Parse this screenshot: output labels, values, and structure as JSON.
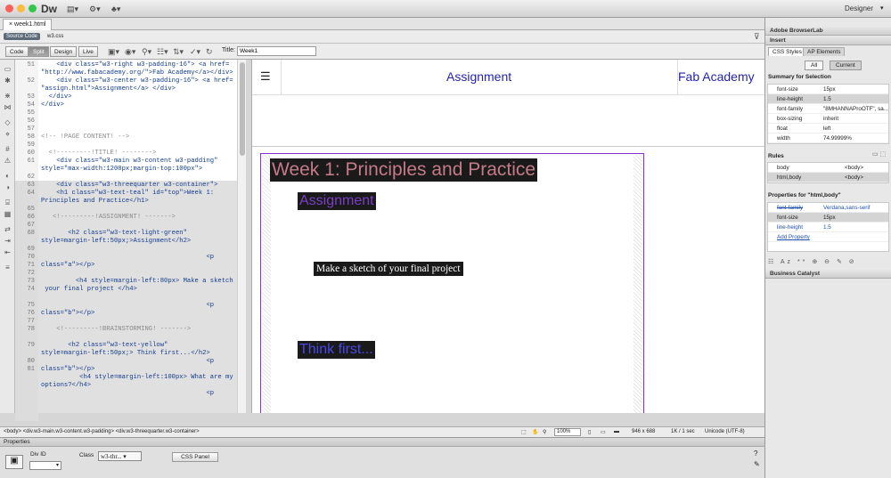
{
  "app": {
    "name": "Dw",
    "workspace": "Designer",
    "toolbar_icons": [
      "layout-menu-icon",
      "gear-menu-icon",
      "site-menu-icon"
    ]
  },
  "doc_tab": {
    "label": "week1.html"
  },
  "related": {
    "source_label": "Source Code",
    "file": "w3.css"
  },
  "views": {
    "code": "Code",
    "split": "Split",
    "design": "Design",
    "live": "Live",
    "active": "Split"
  },
  "title_field": {
    "label": "Title:",
    "value": "Week1"
  },
  "code": {
    "line_numbers": [
      "51",
      "52",
      "53",
      "54",
      "55",
      "56",
      "57",
      "58",
      "59",
      "60",
      "61",
      "62",
      "63",
      "64",
      "65",
      "66",
      "67",
      "68",
      "69",
      "70",
      "71",
      "72",
      "73",
      "74",
      "75",
      "76",
      "77",
      "78",
      "79",
      "80",
      "81"
    ],
    "lines": [
      "    <div class=\"w3-right w3-padding-16\"> <a href=",
      "\"http://www.fabacademy.org/\">Fab Academy</a></div>",
      "    <div class=\"w3-center w3-padding-16\"> <a href=",
      "\"assign.html\">Assignment</a> </div>",
      "  </div>",
      "</div>",
      "",
      "",
      "",
      "<!-- !PAGE CONTENT! -->",
      "",
      "  <!---------!TITLE! -------->",
      "    <div class=\"w3-main w3-content w3-padding\"",
      "style=\"max-width:1200px;margin-top:100px\">",
      "",
      "    <div class=\"w3-threequarter w3-container\">",
      "    <h1 class=\"w3-text-teal\" id=\"top\">Week 1:",
      "Principles and Practice</h1>",
      "",
      "   <!---------!ASSIGNMENT! ------->",
      "",
      "       <h2 class=\"w3-text-light-green\"",
      "style=margin-left:50px;>Assignment</h2>",
      "",
      "                                           <p",
      "class=\"a\"></p>",
      "",
      "         <h4 style=margin-left:80px> Make a sketch of",
      " your final project </h4>",
      "",
      "                                           <p",
      "class=\"b\"></p>",
      "",
      "    <!---------!BRAINSTORMING! ------->",
      "",
      "       <h2 class=\"w3-text-yellow\"",
      "style=margin-left:50px;> Think first...</h2>",
      "                                           <p",
      "class=\"b\"></p>",
      "          <h4 style=margin-left:100px> What are my",
      "options?</h4>",
      "                                           <p"
    ]
  },
  "design": {
    "header_assignment": "Assignment",
    "header_fab": "Fab Academy",
    "h1": "Week 1: Principles and Practice",
    "h2_assignment": "Assignment",
    "h4_sketch": "Make a sketch of your final project",
    "h2_think": "Think first..."
  },
  "status": {
    "tag_selector": "<body> <div.w3-main.w3-content.w3-padding> <div.w3-threequarter.w3-container>",
    "zoom": "100%",
    "dimensions": "946 x 688",
    "download": "1K / 1 sec",
    "encoding": "Unicode (UTF-8)"
  },
  "properties": {
    "title": "Properties",
    "div_id_label": "Div ID",
    "class_label": "Class",
    "class_value": "w3-thr...",
    "css_panel_button": "CSS Panel"
  },
  "right_panel": {
    "browserlab": "Adobe BrowserLab",
    "insert": "Insert",
    "tab_css": "CSS Styles",
    "tab_ap": "AP Elements",
    "seg_all": "All",
    "seg_current": "Current",
    "summary_title": "Summary for Selection",
    "summary": [
      {
        "prop": "font-size",
        "val": "15px"
      },
      {
        "prop": "line-height",
        "val": "1.5"
      },
      {
        "prop": "font-family",
        "val": "\"8MHANNAProOTF\", sa..."
      },
      {
        "prop": "box-sizing",
        "val": "inherit"
      },
      {
        "prop": "float",
        "val": "left"
      },
      {
        "prop": "width",
        "val": "74.99999%"
      }
    ],
    "rules_title": "Rules",
    "rules": [
      {
        "sel": "body",
        "tag": "<body>"
      },
      {
        "sel": "html,body",
        "tag": "<body>"
      }
    ],
    "props_title": "Properties for \"html,body\"",
    "props": [
      {
        "prop": "font-family",
        "val": "Verdana,sans-serif"
      },
      {
        "prop": "font-size",
        "val": "15px"
      },
      {
        "prop": "line-height",
        "val": "1.5"
      }
    ],
    "add_property": "Add Property",
    "business_catalyst": "Business Catalyst"
  },
  "colors": {
    "accent": "#5d6a7a",
    "container_outline": "#8c2fd0",
    "link_blue": "#2424b0"
  }
}
